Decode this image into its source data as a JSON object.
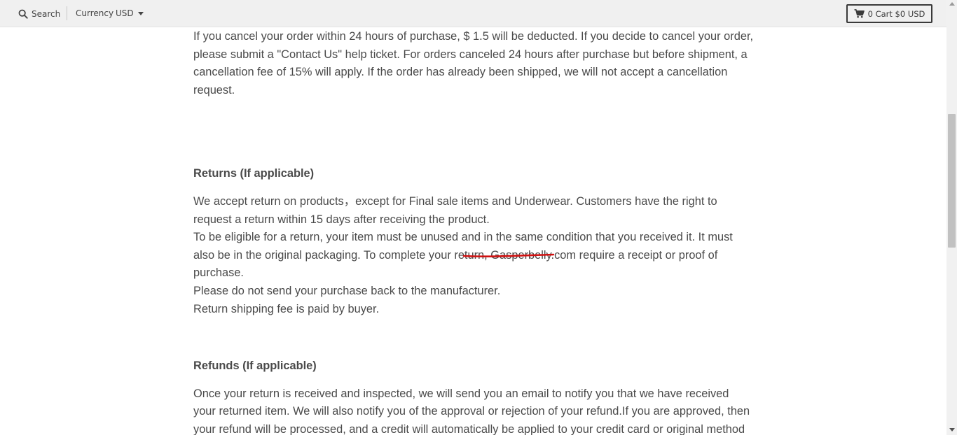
{
  "topbar": {
    "search_label": "Search",
    "currency_label": "Currency",
    "currency_value": "USD",
    "cart_label": "0 Cart $0 USD"
  },
  "policy": {
    "cancel_paragraph": "If you cancel your order within 24 hours of purchase, $ 1.5 will be deducted. If you decide to cancel your order, please submit a \"Contact Us\" help ticket. For orders canceled 24 hours after purchase but before shipment, a cancellation fee of 15% will apply. If the order has already been shipped, we will not accept a cancellation request.",
    "returns_heading": "Returns (If applicable)",
    "returns_p1": "We accept return on products，except for Final sale items and Underwear. Customers have the right to request a return within 15 days after receiving the product.",
    "returns_p2_before": "To be eligible for a return, your item must be unused and in the same condition that you received it. It must also be in the original packaging. To complete your return, ",
    "returns_p2_link": "Gasperbelly.com ",
    "returns_p2_after": "require a receipt or proof of purchase.",
    "returns_p3": "Please do not send your purchase back to the manufacturer.",
    "returns_p4": "Return shipping fee is paid by buyer.",
    "refunds_heading": "Refunds (If applicable)",
    "refunds_p1": "Once your return is received and inspected, we will send you an email to notify you that we have received your returned item. We will also notify you of the approval or rejection of your refund.If you are approved, then your refund will be processed, and a credit will automatically be applied to your credit card or original method of payment, within a certain amount of days."
  },
  "colors": {
    "annotation": "#d01010",
    "text": "#4a4a4a",
    "topbar_bg": "#f0f0f0"
  }
}
